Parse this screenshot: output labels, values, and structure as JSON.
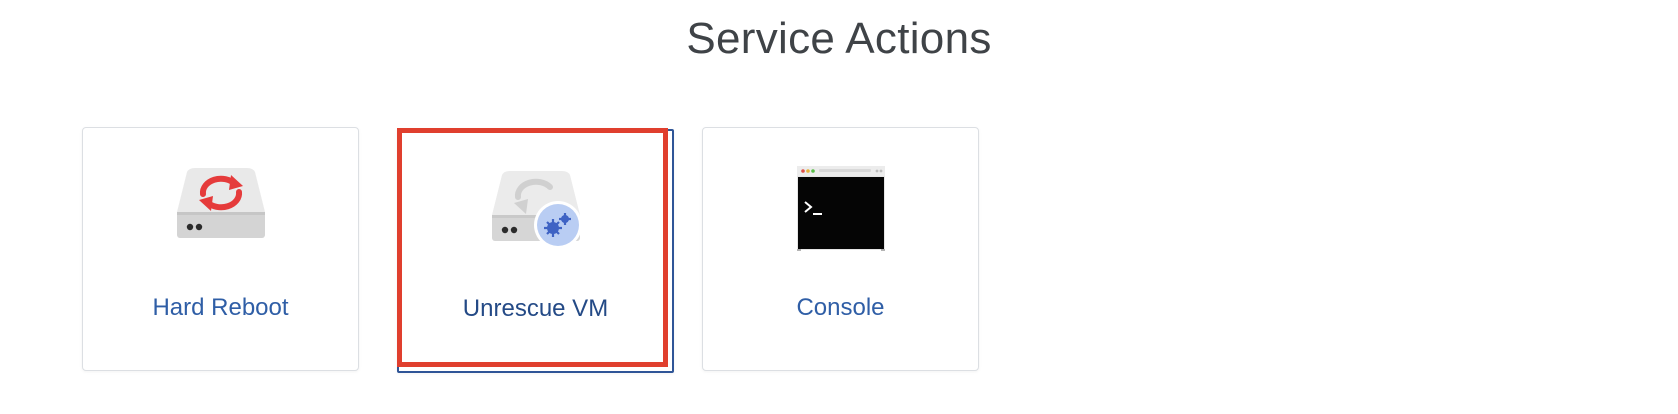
{
  "page": {
    "title": "Service Actions"
  },
  "actions": [
    {
      "label": "Hard Reboot",
      "icon": "hard-reboot-icon"
    },
    {
      "label": "Unrescue VM",
      "icon": "unrescue-vm-icon",
      "highlighted": true
    },
    {
      "label": "Console",
      "icon": "console-terminal-icon"
    }
  ],
  "colors": {
    "title": "#3f4347",
    "link": "#2f5ea6",
    "card_border": "#dcdfe3",
    "highlight": "#e03f2e",
    "selected_border": "#2f5597",
    "reboot_arrows": "#e53b3b",
    "gear_badge": "#b9cdf3",
    "gear": "#3f63c4"
  }
}
